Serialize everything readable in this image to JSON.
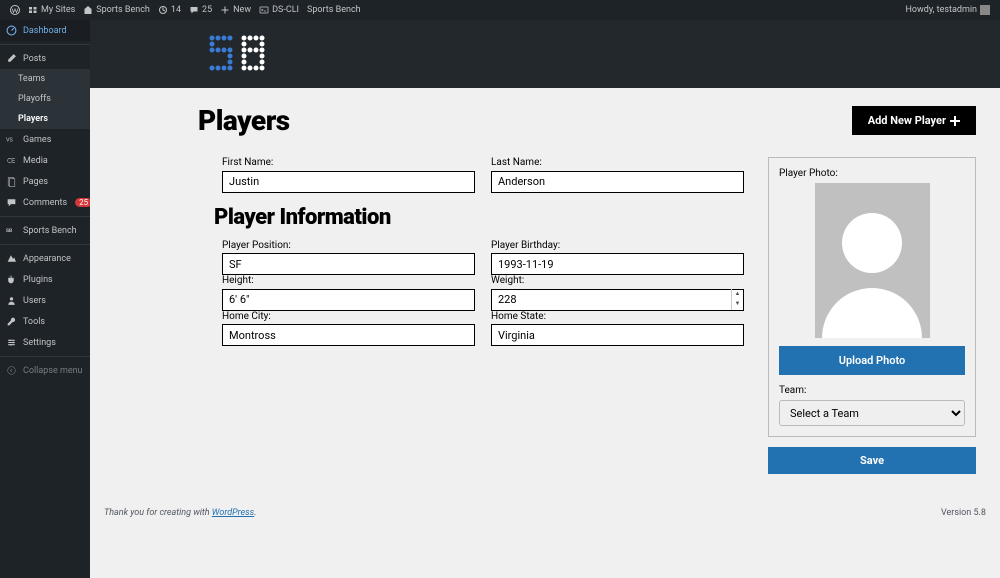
{
  "adminbar": {
    "mysites": "My Sites",
    "sitename": "Sports Bench",
    "updates": "14",
    "comments": "25",
    "new": "New",
    "dscli": "DS-CLI",
    "sb": "Sports Bench",
    "howdy": "Howdy, testadmin"
  },
  "sidebar": {
    "dashboard": "Dashboard",
    "posts": "Posts",
    "teams": "Teams",
    "playoffs": "Playoffs",
    "players": "Players",
    "games": "Games",
    "media": "Media",
    "pages": "Pages",
    "comments": "Comments",
    "comments_badge": "25",
    "sportsbench": "Sports Bench",
    "appearance": "Appearance",
    "plugins": "Plugins",
    "users": "Users",
    "tools": "Tools",
    "settings": "Settings",
    "collapse": "Collapse menu"
  },
  "page": {
    "title": "Players",
    "addnew": "Add New Player",
    "section2": "Player Information"
  },
  "labels": {
    "first_name": "First Name:",
    "last_name": "Last Name:",
    "position": "Player Position:",
    "birthday": "Player Birthday:",
    "height": "Height:",
    "weight": "Weight:",
    "home_city": "Home City:",
    "home_state": "Home State:",
    "photo": "Player Photo:",
    "upload": "Upload Photo",
    "team": "Team:",
    "team_default": "Select a Team",
    "save": "Save"
  },
  "values": {
    "first_name": "Justin",
    "last_name": "Anderson",
    "position": "SF",
    "birthday": "1993-11-19",
    "height": "6' 6\"",
    "weight": "228",
    "home_city": "Montross",
    "home_state": "Virginia"
  },
  "footer": {
    "thanks_pre": "Thank you for creating with ",
    "thanks_link": "WordPress",
    "thanks_post": ".",
    "version": "Version 5.8"
  }
}
